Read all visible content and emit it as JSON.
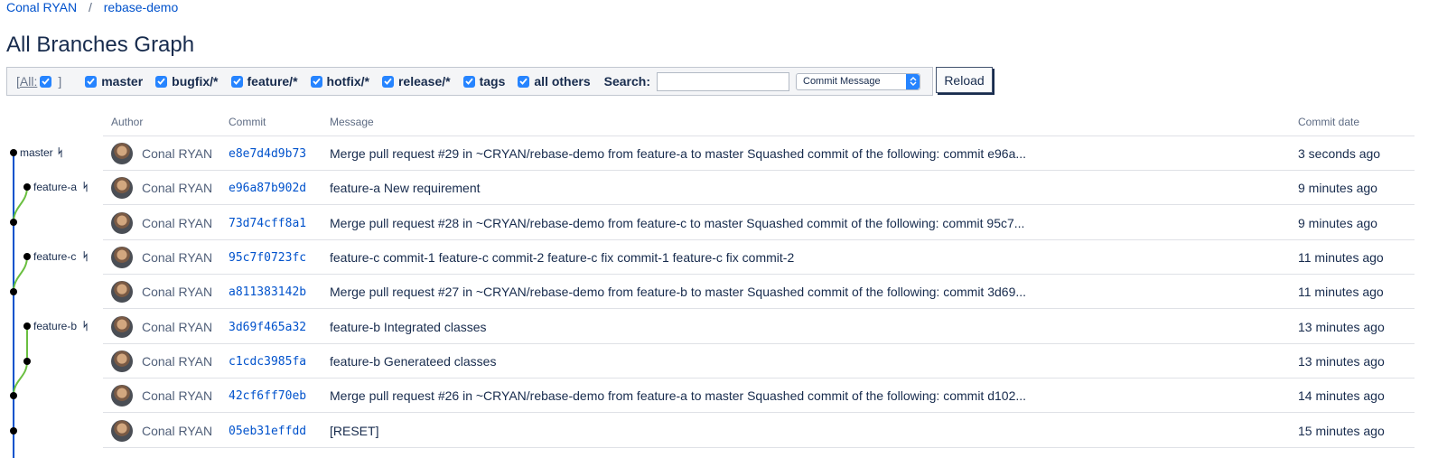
{
  "breadcrumb": {
    "user": "Conal RYAN",
    "separator": "/",
    "repo": "rebase-demo"
  },
  "page_title": "All Branches Graph",
  "filters": {
    "all_prefix": "[",
    "all_label": "All:",
    "all_suffix": "]",
    "items": [
      {
        "label": "master",
        "checked": true
      },
      {
        "label": "bugfix/*",
        "checked": true
      },
      {
        "label": "feature/*",
        "checked": true
      },
      {
        "label": "hotfix/*",
        "checked": true
      },
      {
        "label": "release/*",
        "checked": true
      },
      {
        "label": "tags",
        "checked": true
      },
      {
        "label": "all others",
        "checked": true
      }
    ],
    "search_label": "Search:",
    "search_value": "",
    "search_mode": "Commit Message",
    "reload_label": "Reload"
  },
  "table": {
    "headers": {
      "author": "Author",
      "commit": "Commit",
      "message": "Message",
      "date": "Commit date"
    },
    "rows": [
      {
        "author": "Conal RYAN",
        "hash": "e8e7d4d9b73",
        "message": "Merge pull request #29 in ~CRYAN/rebase-demo from feature-a to master Squashed commit of the following: commit e96a...",
        "date": "3 seconds ago"
      },
      {
        "author": "Conal RYAN",
        "hash": "e96a87b902d",
        "message": "feature-a New requirement",
        "date": "9 minutes ago"
      },
      {
        "author": "Conal RYAN",
        "hash": "73d74cff8a1",
        "message": "Merge pull request #28 in ~CRYAN/rebase-demo from feature-c to master Squashed commit of the following: commit 95c7...",
        "date": "9 minutes ago"
      },
      {
        "author": "Conal RYAN",
        "hash": "95c7f0723fc",
        "message": "feature-c commit-1 feature-c commit-2 feature-c fix commit-1 feature-c fix commit-2",
        "date": "11 minutes ago"
      },
      {
        "author": "Conal RYAN",
        "hash": "a811383142b",
        "message": "Merge pull request #27 in ~CRYAN/rebase-demo from feature-b to master Squashed commit of the following: commit 3d69...",
        "date": "11 minutes ago"
      },
      {
        "author": "Conal RYAN",
        "hash": "3d69f465a32",
        "message": "feature-b Integrated classes",
        "date": "13 minutes ago"
      },
      {
        "author": "Conal RYAN",
        "hash": "c1cdc3985fa",
        "message": "feature-b Generateed classes",
        "date": "13 minutes ago"
      },
      {
        "author": "Conal RYAN",
        "hash": "42cf6ff70eb",
        "message": "Merge pull request #26 in ~CRYAN/rebase-demo from feature-a to master Squashed commit of the following: commit d102...",
        "date": "14 minutes ago"
      },
      {
        "author": "Conal RYAN",
        "hash": "05eb31effdd",
        "message": "[RESET]",
        "date": "15 minutes ago"
      }
    ]
  },
  "graph": {
    "branch_labels": [
      "master",
      "feature-a",
      "feature-c",
      "feature-b"
    ],
    "branch_icon": "branch-icon",
    "colors": {
      "main_line": "#0052cc",
      "branch_line": "#6abf40",
      "node": "#000000"
    }
  }
}
